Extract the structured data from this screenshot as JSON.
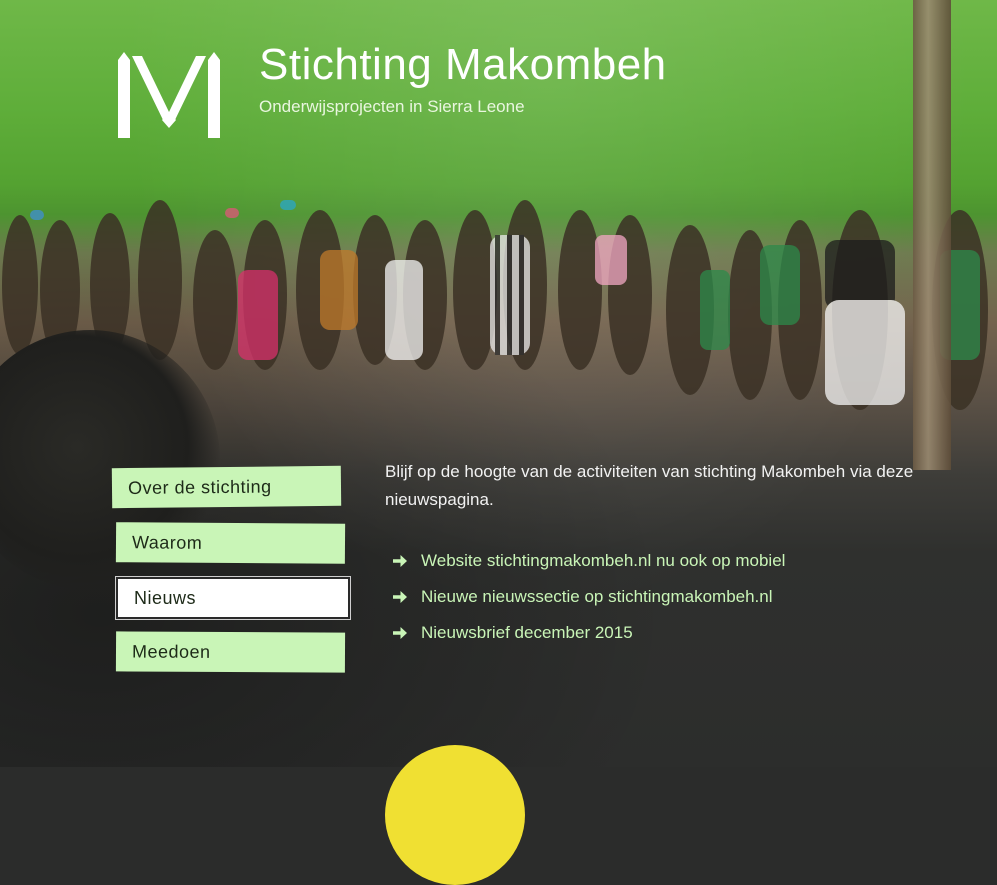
{
  "header": {
    "title": "Stichting Makombeh",
    "subtitle": "Onderwijsprojecten in Sierra Leone",
    "logo_icon": "makombeh-m-logo-icon"
  },
  "nav": {
    "items": [
      {
        "label": "Over de stichting",
        "active": false
      },
      {
        "label": "Waarom",
        "active": false
      },
      {
        "label": "Nieuws",
        "active": true
      },
      {
        "label": "Meedoen",
        "active": false
      }
    ]
  },
  "main": {
    "intro": "Blijf op de hoogte van de activiteiten van stichting Makombeh via deze nieuwspagina.",
    "news": [
      {
        "label": "Website stichtingmakombeh.nl nu ook op mobiel",
        "icon": "arrow-right-icon"
      },
      {
        "label": "Nieuwe nieuwssectie op stichtingmakombeh.nl",
        "icon": "arrow-right-icon"
      },
      {
        "label": "Nieuwsbrief december 2015",
        "icon": "arrow-right-icon"
      }
    ]
  },
  "colors": {
    "accent_green": "#c9f5b7",
    "background_dark": "#2b2c2b",
    "header_green": "#5fae3a"
  }
}
